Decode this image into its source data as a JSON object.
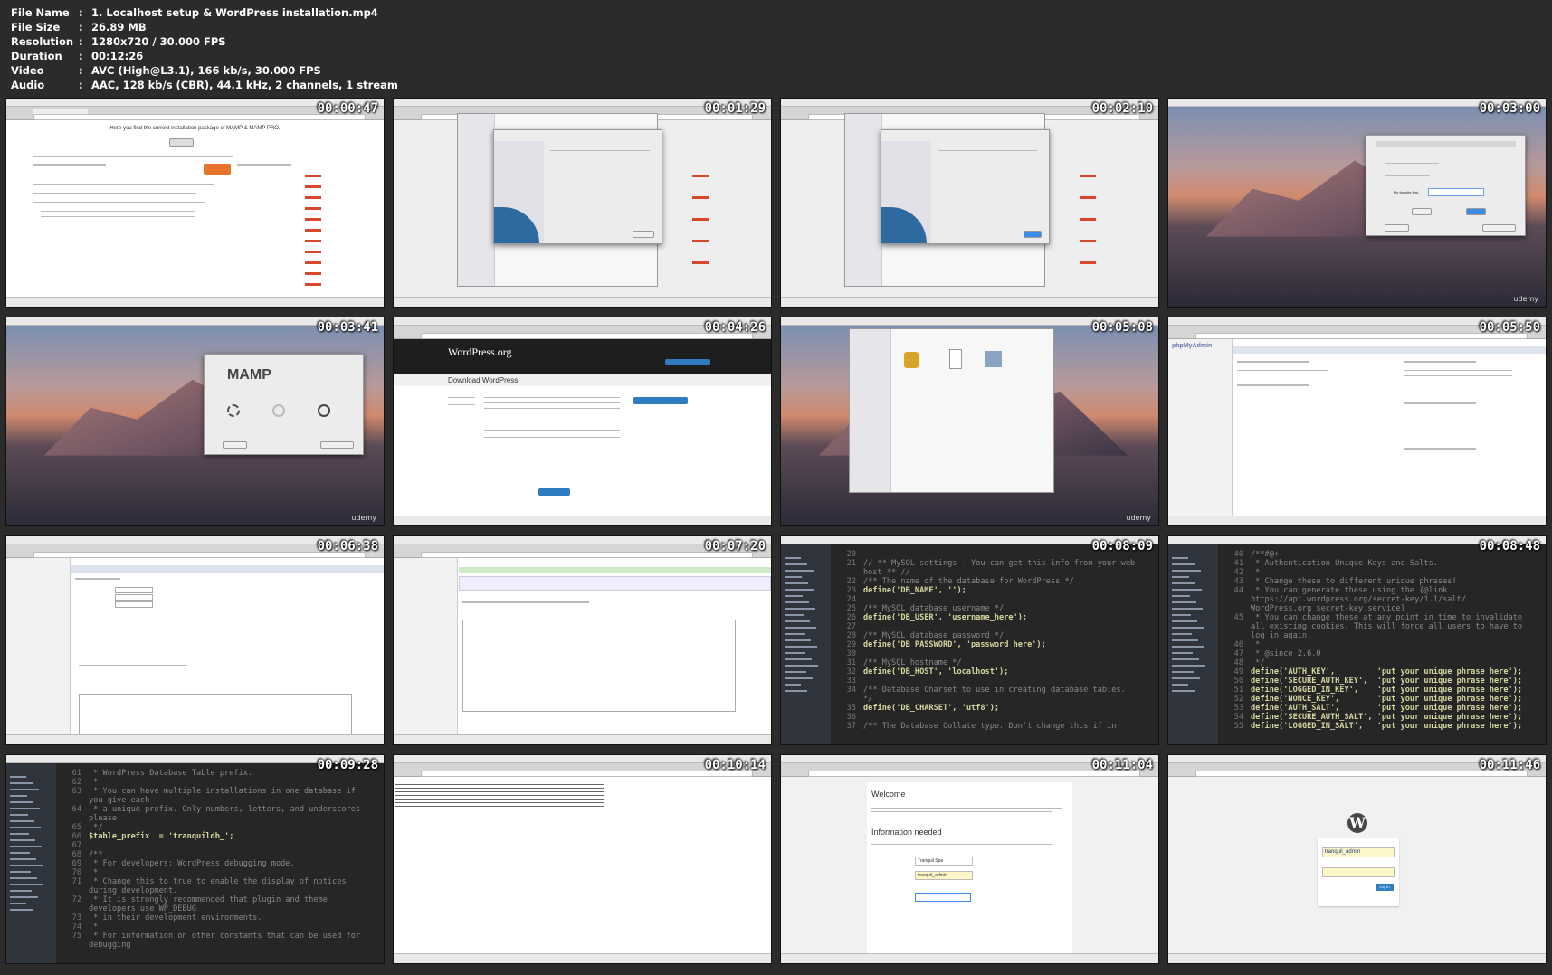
{
  "info": {
    "file_name_label": "File Name",
    "file_name": "1. Localhost setup & WordPress installation.mp4",
    "file_size_label": "File Size",
    "file_size": "26.89 MB",
    "resolution_label": "Resolution",
    "resolution": "1280x720 / 30.000 FPS",
    "duration_label": "Duration",
    "duration": "00:12:26",
    "video_label": "Video",
    "video": "AVC (High@L3.1), 166 kb/s, 30.000 FPS",
    "audio_label": "Audio",
    "audio": "AAC, 128 kb/s (CBR), 44.1 kHz, 2 channels, 1 stream",
    "separator": ":"
  },
  "thumbs": [
    {
      "timestamp": "00:00:47",
      "scene": "Chrome – MAMP downloads page"
    },
    {
      "timestamp": "00:01:29",
      "scene": "MAMP installer"
    },
    {
      "timestamp": "00:02:10",
      "scene": "MAMP installer complete"
    },
    {
      "timestamp": "00:03:00",
      "scene": "MAMP preferences"
    },
    {
      "timestamp": "00:03:41",
      "scene": "MAMP start window"
    },
    {
      "timestamp": "00:04:26",
      "scene": "WordPress.org download"
    },
    {
      "timestamp": "00:05:08",
      "scene": "Finder downloads"
    },
    {
      "timestamp": "00:05:50",
      "scene": "phpMyAdmin"
    },
    {
      "timestamp": "00:06:38",
      "scene": "phpMyAdmin add user"
    },
    {
      "timestamp": "00:07:20",
      "scene": "phpMyAdmin privileges"
    },
    {
      "timestamp": "00:08:09",
      "scene": "Brackets wp-config database"
    },
    {
      "timestamp": "00:08:48",
      "scene": "Brackets wp-config keys"
    },
    {
      "timestamp": "00:09:28",
      "scene": "Brackets wp-config table prefix"
    },
    {
      "timestamp": "00:10:14",
      "scene": "Secret keys page"
    },
    {
      "timestamp": "00:11:04",
      "scene": "WordPress installation"
    },
    {
      "timestamp": "00:11:46",
      "scene": "WordPress login"
    }
  ],
  "texts": {
    "downloads_heading": "Here you find the current installation package of MAMP & MAMP PRO.",
    "mamp_logo": "MAMP",
    "wp_logo": "WordPress.org",
    "wp_download_title": "Download WordPress",
    "pma_logo": "phpMyAdmin",
    "udemy": "udemy",
    "welcome": "Welcome",
    "info_needed": "Information needed",
    "site_title_val": "Tranquil Spa",
    "username_val": "tranquil_admin",
    "login_user": "tranquil_admin",
    "login_btn": "Log In",
    "prefs_favorite": "My favorite link:",
    "code1": [
      {
        "n": "20",
        "t": "",
        "c": "cm"
      },
      {
        "n": "21",
        "t": "// ** MySQL settings - You can get this info from your web",
        "c": "cm"
      },
      {
        "n": "",
        "t": "host ** //",
        "c": "cm"
      },
      {
        "n": "22",
        "t": "/** The name of the database for WordPress */",
        "c": "cm"
      },
      {
        "n": "23",
        "t": "define('DB_NAME', '');",
        "c": "kw"
      },
      {
        "n": "24",
        "t": "",
        "c": "cm"
      },
      {
        "n": "25",
        "t": "/** MySQL database username */",
        "c": "cm"
      },
      {
        "n": "26",
        "t": "define('DB_USER', 'username_here');",
        "c": "kw"
      },
      {
        "n": "27",
        "t": "",
        "c": "cm"
      },
      {
        "n": "28",
        "t": "/** MySQL database password */",
        "c": "cm"
      },
      {
        "n": "29",
        "t": "define('DB_PASSWORD', 'password_here');",
        "c": "kw"
      },
      {
        "n": "30",
        "t": "",
        "c": "cm"
      },
      {
        "n": "31",
        "t": "/** MySQL hostname */",
        "c": "cm"
      },
      {
        "n": "32",
        "t": "define('DB_HOST', 'localhost');",
        "c": "kw"
      },
      {
        "n": "33",
        "t": "",
        "c": "cm"
      },
      {
        "n": "34",
        "t": "/** Database Charset to use in creating database tables.",
        "c": "cm"
      },
      {
        "n": "",
        "t": "*/",
        "c": "cm"
      },
      {
        "n": "35",
        "t": "define('DB_CHARSET', 'utf8');",
        "c": "kw"
      },
      {
        "n": "36",
        "t": "",
        "c": "cm"
      },
      {
        "n": "37",
        "t": "/** The Database Collate type. Don't change this if in",
        "c": "cm"
      }
    ],
    "code2": [
      {
        "n": "40",
        "t": "/**#@+",
        "c": "cm"
      },
      {
        "n": "41",
        "t": " * Authentication Unique Keys and Salts.",
        "c": "cm"
      },
      {
        "n": "42",
        "t": " *",
        "c": "cm"
      },
      {
        "n": "43",
        "t": " * Change these to different unique phrases!",
        "c": "cm"
      },
      {
        "n": "44",
        "t": " * You can generate these using the {@link",
        "c": "cm"
      },
      {
        "n": "",
        "t": "https://api.wordpress.org/secret-key/1.1/salt/",
        "c": "cm"
      },
      {
        "n": "",
        "t": "WordPress.org secret-key service}",
        "c": "cm"
      },
      {
        "n": "45",
        "t": " * You can change these at any point in time to invalidate",
        "c": "cm"
      },
      {
        "n": "",
        "t": "all existing cookies. This will force all users to have to",
        "c": "cm"
      },
      {
        "n": "",
        "t": "log in again.",
        "c": "cm"
      },
      {
        "n": "46",
        "t": " *",
        "c": "cm"
      },
      {
        "n": "47",
        "t": " * @since 2.6.0",
        "c": "cm"
      },
      {
        "n": "48",
        "t": " */",
        "c": "cm"
      },
      {
        "n": "49",
        "t": "define('AUTH_KEY',         'put your unique phrase here');",
        "c": "kw"
      },
      {
        "n": "50",
        "t": "define('SECURE_AUTH_KEY',  'put your unique phrase here');",
        "c": "kw"
      },
      {
        "n": "51",
        "t": "define('LOGGED_IN_KEY',    'put your unique phrase here');",
        "c": "kw"
      },
      {
        "n": "52",
        "t": "define('NONCE_KEY',        'put your unique phrase here');",
        "c": "kw"
      },
      {
        "n": "53",
        "t": "define('AUTH_SALT',        'put your unique phrase here');",
        "c": "kw"
      },
      {
        "n": "54",
        "t": "define('SECURE_AUTH_SALT', 'put your unique phrase here');",
        "c": "kw"
      },
      {
        "n": "55",
        "t": "define('LOGGED_IN_SALT',   'put your unique phrase here');",
        "c": "kw"
      }
    ],
    "code3": [
      {
        "n": "61",
        "t": " * WordPress Database Table prefix.",
        "c": "cm"
      },
      {
        "n": "62",
        "t": " *",
        "c": "cm"
      },
      {
        "n": "63",
        "t": " * You can have multiple installations in one database if",
        "c": "cm"
      },
      {
        "n": "",
        "t": "you give each",
        "c": "cm"
      },
      {
        "n": "64",
        "t": " * a unique prefix. Only numbers, letters, and underscores",
        "c": "cm"
      },
      {
        "n": "",
        "t": "please!",
        "c": "cm"
      },
      {
        "n": "65",
        "t": " */",
        "c": "cm"
      },
      {
        "n": "66",
        "t": "$table_prefix  = 'tranquildb_';",
        "c": "kw"
      },
      {
        "n": "67",
        "t": "",
        "c": "cm"
      },
      {
        "n": "68",
        "t": "/**",
        "c": "cm"
      },
      {
        "n": "69",
        "t": " * For developers: WordPress debugging mode.",
        "c": "cm"
      },
      {
        "n": "70",
        "t": " *",
        "c": "cm"
      },
      {
        "n": "71",
        "t": " * Change this to true to enable the display of notices",
        "c": "cm"
      },
      {
        "n": "",
        "t": "during development.",
        "c": "cm"
      },
      {
        "n": "72",
        "t": " * It is strongly recommended that plugin and theme",
        "c": "cm"
      },
      {
        "n": "",
        "t": "developers use WP_DEBUG",
        "c": "cm"
      },
      {
        "n": "73",
        "t": " * in their development environments.",
        "c": "cm"
      },
      {
        "n": "74",
        "t": " *",
        "c": "cm"
      },
      {
        "n": "75",
        "t": " * For information on other constants that can be used for",
        "c": "cm"
      },
      {
        "n": "",
        "t": "debugging",
        "c": "cm"
      }
    ]
  }
}
